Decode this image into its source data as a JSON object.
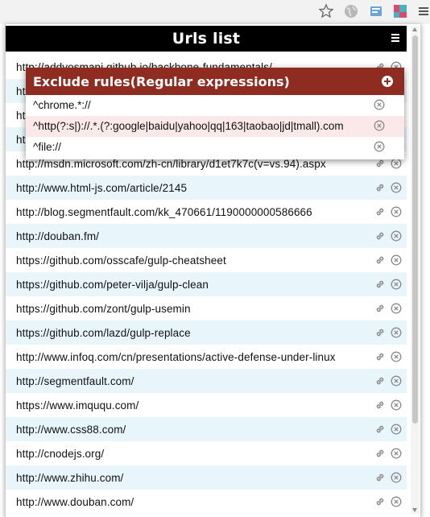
{
  "browser": {
    "toolbar_icons": [
      "star-icon",
      "globe-icon",
      "page-icon",
      "extension-icon",
      "menu-icon"
    ]
  },
  "popup": {
    "title": "Urls list",
    "urls": [
      "http://addyosmani.github.io/backbone-fundamentals/",
      "https://...",
      "http://...",
      "https://...",
      "http://msdn.microsoft.com/zh-cn/library/d1et7k7c(v=vs.94).aspx",
      "http://www.html-js.com/article/2145",
      "http://blog.segmentfault.com/kk_470661/1190000000586666",
      "http://douban.fm/",
      "https://github.com/osscafe/gulp-cheatsheet",
      "https://github.com/peter-vilja/gulp-clean",
      "https://github.com/zont/gulp-usemin",
      "https://github.com/lazd/gulp-replace",
      "http://www.infoq.com/cn/presentations/active-defense-under-linux",
      "http://segmentfault.com/",
      "https://www.imququ.com/",
      "http://www.css88.com/",
      "http://cnodejs.org/",
      "http://www.zhihu.com/",
      "http://www.douban.com/"
    ]
  },
  "rules": {
    "title": "Exclude rules(Regular expressions)",
    "items": [
      "^chrome.*://",
      "^http(?:s|)://.*.(?:google|baidu|yahoo|qq|163|taobao|jd|tmall).com",
      "^file://"
    ],
    "highlighted_index": 1
  },
  "colors": {
    "header_bg": "#000000",
    "rules_header_bg": "#8f2c22",
    "row_alt_bg": "#e8f6fb",
    "rule_highlight_bg": "#fbe8e8"
  }
}
